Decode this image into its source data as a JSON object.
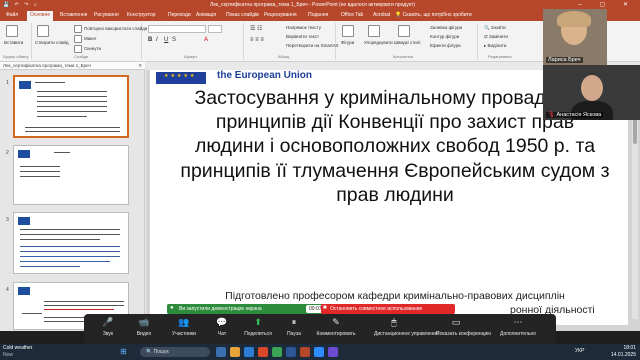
{
  "window": {
    "title": "Лек_сертифікатна програма_тема 1_Бреч - PowerPoint (не вдалося активувати продукт)"
  },
  "menu": {
    "tabs": [
      "Файл",
      "Основне",
      "Вставлення",
      "Рисування",
      "Конструктор",
      "Переходи",
      "Анімація",
      "Показ слайдів",
      "Рецензування",
      "Подання",
      "Office Tab",
      "Acrobat"
    ],
    "active": "Основне",
    "tell_me": "Скажіть, що потрібно зробити"
  },
  "ribbon": {
    "paste": "Вставити",
    "new_slide": "Створити слайд",
    "reuse": "Повторно використати слайди",
    "layout": "Макет",
    "reset": "Скинути",
    "section": "Розділ",
    "text_direction": "Напрямок тексту",
    "align_text": "Вирівняти текст",
    "smartart": "Перетворити на SmartArt",
    "shapes": "Фігури",
    "arrange": "Упорядкувати",
    "quick_styles": "Швидкі стилі",
    "shape_fill": "Заливка фігури",
    "shape_outline": "Контур фігури",
    "shape_effects": "Ефекти фігури",
    "find": "Знайти",
    "replace": "Замінити",
    "select": "Виділити",
    "groups": [
      "Буфер обміну",
      "Слайди",
      "Шрифт",
      "Абзац",
      "Креслення",
      "Редагування"
    ]
  },
  "file_tab": "Лек_сертифікатна програма_тема 1_Бреч",
  "thumbnails": {
    "numbers": [
      "1",
      "2",
      "3",
      "4"
    ]
  },
  "slide": {
    "header": "the European Union",
    "title": "Застосування у кримінальному провадженні принципів дії Конвенції про захист прав людини і основоположних свобод 1950 р. та принципів її тлумачення Європейським судом з прав людини",
    "footer_line1": "Підготовлено професором кафедри кримінально-правових дисциплін",
    "footer_line2": "ронної діяльності"
  },
  "participants": {
    "tile1": "Лариса Бреч",
    "tile2": "Анастасія Яскова"
  },
  "share": {
    "notice": "Ви запустили демонстрацію екрана",
    "timer": "00:07:06",
    "stop": "Остановить совместное использование"
  },
  "zoom_controls": [
    {
      "name": "audio",
      "icon": "🎤",
      "label": "Звук"
    },
    {
      "name": "video",
      "icon": "📹",
      "label": "Видео"
    },
    {
      "name": "participants",
      "icon": "👥",
      "label": "Участники"
    },
    {
      "name": "chat",
      "icon": "💬",
      "label": "Чат"
    },
    {
      "name": "share",
      "icon": "⬆",
      "label": "Поделиться"
    },
    {
      "name": "pause",
      "icon": "⏸",
      "label": "Пауза"
    },
    {
      "name": "annotate",
      "icon": "✎",
      "label": "Комментировать"
    },
    {
      "name": "remote",
      "icon": "🖱",
      "label": "Дистанционное управление"
    },
    {
      "name": "hide-video",
      "icon": "▭",
      "label": "Показать конференцию"
    },
    {
      "name": "more",
      "icon": "⋯",
      "label": "Дополнительно"
    }
  ],
  "taskbar": {
    "weather_title": "Cold weather",
    "weather_sub": "Now",
    "search_placeholder": "Пошук",
    "lang": "УКР",
    "time": "18:01",
    "date": "14.01.2025"
  },
  "colors": {
    "ppt_accent": "#b7472a",
    "share_green": "#2d8c3c",
    "stop_red": "#e02828",
    "eu_blue": "#1f3f9a"
  }
}
